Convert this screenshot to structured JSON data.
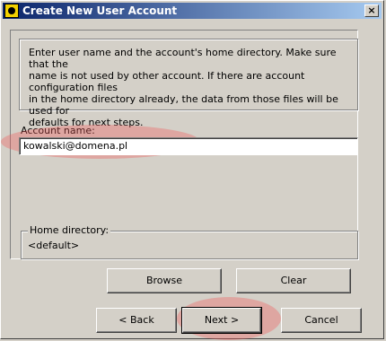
{
  "window": {
    "title": "Create New User Account",
    "close_glyph": "×"
  },
  "info_text": "Enter user name and the account's home directory. Make sure that the\nname is not used by other account. If there are account configuration files\nin the home directory already, the data from those files will be used for\ndefaults for next steps.",
  "account": {
    "label": "Account name:",
    "value": "kowalski@domena.pl"
  },
  "home": {
    "label": "Home directory:",
    "value": "<default>"
  },
  "buttons": {
    "browse": "Browse",
    "clear": "Clear",
    "back": "<  Back",
    "next": "Next  >",
    "cancel": "Cancel"
  },
  "colors": {
    "face": "#d4d0c8",
    "title_start": "#0a246a",
    "title_end": "#a6caf0",
    "highlight": "#f05a5a"
  }
}
